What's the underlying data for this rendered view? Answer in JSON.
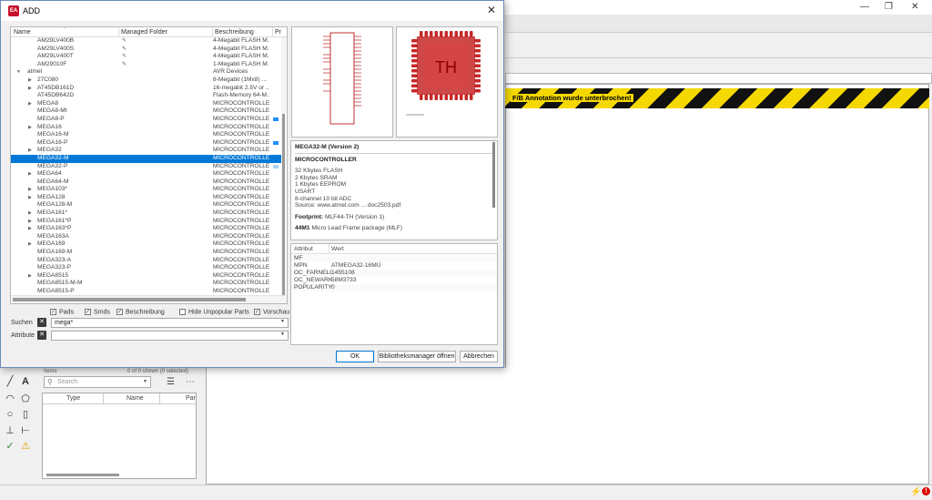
{
  "dialog": {
    "title": "ADD",
    "close": "✕"
  },
  "tree": {
    "columns": [
      "Name",
      "Managed Folder",
      "Beschreibung",
      "Pr"
    ],
    "rows": [
      {
        "name": "AM29LV400B",
        "desc": "4-Megabit FLASH M...",
        "pin": true
      },
      {
        "name": "AM29LV400S",
        "desc": "4-Megabit FLASH M...",
        "pin": true
      },
      {
        "name": "AM29LV400T",
        "desc": "4-Megabit FLASH M...",
        "pin": true
      },
      {
        "name": "AM29010F",
        "desc": "1-Megabit FLASH M...",
        "pin": true
      },
      {
        "name": "atmel",
        "desc": "AVR Devices",
        "group": true,
        "exp": "▼"
      },
      {
        "name": "27C080",
        "desc": "8-Megabit (1Mx8) ...",
        "exp": "▶"
      },
      {
        "name": "AT45DB161D",
        "desc": "16-megabit 2.5V or ...",
        "exp": "▶"
      },
      {
        "name": "AT45DB642D",
        "desc": "Flash-Memory 64-M..."
      },
      {
        "name": "MEGA8",
        "desc": "MICROCONTROLLER",
        "exp": "▶"
      },
      {
        "name": "MEGA8-MI",
        "desc": "MICROCONTROLLER"
      },
      {
        "name": "MEGA8-P",
        "desc": "MICROCONTROLLER",
        "mark": "dark"
      },
      {
        "name": "MEGA16",
        "desc": "MICROCONTROLLER",
        "exp": "▶"
      },
      {
        "name": "MEGA16-M",
        "desc": "MICROCONTROLLER"
      },
      {
        "name": "MEGA16-P",
        "desc": "MICROCONTROLLER",
        "mark": "dark"
      },
      {
        "name": "MEGA32",
        "desc": "MICROCONTROLLER",
        "exp": "▶"
      },
      {
        "name": "MEGA32-M",
        "desc": "MICROCONTROLLER",
        "sel": true
      },
      {
        "name": "MEGA32-P",
        "desc": "MICROCONTROLLER",
        "mark": "light"
      },
      {
        "name": "MEGA64",
        "desc": "MICROCONTROLLER",
        "exp": "▶"
      },
      {
        "name": "MEGA64-M",
        "desc": "MICROCONTROLLER"
      },
      {
        "name": "MEGA103*",
        "desc": "MICROCONTROLLER",
        "exp": "▶"
      },
      {
        "name": "MEGA128",
        "desc": "MICROCONTROLLER",
        "exp": "▶"
      },
      {
        "name": "MEGA128-M",
        "desc": "MICROCONTROLLER"
      },
      {
        "name": "MEGA161*",
        "desc": "MICROCONTROLLER",
        "exp": "▶"
      },
      {
        "name": "MEGA161*P",
        "desc": "MICROCONTROLLER",
        "exp": "▶"
      },
      {
        "name": "MEGA163*P",
        "desc": "MICROCONTROLLER",
        "exp": "▶"
      },
      {
        "name": "MEGA163A",
        "desc": "MICROCONTROLLER"
      },
      {
        "name": "MEGA169",
        "desc": "MICROCONTROLLER",
        "exp": "▶"
      },
      {
        "name": "MEGA169-M",
        "desc": "MICROCONTROLLER"
      },
      {
        "name": "MEGA323-A",
        "desc": "MICROCONTROLLER"
      },
      {
        "name": "MEGA323-P",
        "desc": "MICROCONTROLLER"
      },
      {
        "name": "MEGA8515",
        "desc": "MICROCONTROLLER",
        "exp": "▶"
      },
      {
        "name": "MEGA8515-M-M",
        "desc": "MICROCONTROLLER"
      },
      {
        "name": "MEGA8515-P",
        "desc": "MICROCONTROLLER"
      }
    ]
  },
  "filters": {
    "pads": "Pads",
    "smds": "Smds",
    "beschreibung": "Beschreibung",
    "hide_unpopular": "Hide Unpopular Parts",
    "vorschau": "Vorschau"
  },
  "search": {
    "label": "Suchen",
    "value": "mega*",
    "clear": "✕"
  },
  "attribute": {
    "label": "Attribute",
    "value": "",
    "clear": "✕"
  },
  "footprint_label": "TH",
  "description": {
    "title": "MEGA32-M (Version 2)",
    "subtitle": "MICROCONTROLLER",
    "lines": [
      "32 Kbytes FLASH",
      "2 Kbytes SRAM",
      "1 Kbytes EEPROM",
      "USART",
      "8-channel 10 bit ADC",
      "Source: www.atmel.com ... doc2503.pdf"
    ],
    "footprint_label": "Footprint:",
    "footprint": "MLF44-TH (Version 1)",
    "package_name": "44M1",
    "package_desc": "Micro Lead Frame package (MLF)"
  },
  "attributes": {
    "header_key": "Attribut",
    "header_val": "Wert",
    "rows": [
      {
        "k": "MF",
        "v": ""
      },
      {
        "k": "MPN",
        "v": "ATMEGA32-16MU"
      },
      {
        "k": "OC_FARNELL",
        "v": "1455108"
      },
      {
        "k": "OC_NEWARK",
        "v": "58M3733"
      },
      {
        "k": "POPULARITY",
        "v": "0"
      }
    ]
  },
  "buttons": {
    "ok": "OK",
    "manager": "Bibliotheksmanager öffnen",
    "cancel": "Abbrechen"
  },
  "background": {
    "warning": "F/B Annotation wurde unterbrochen!",
    "search_placeholder": "Search",
    "shown": "0 of 0 shown (0 selected)",
    "items": "Items",
    "cols": [
      "Type",
      "Name",
      "Par"
    ],
    "window_controls": [
      "—",
      "❐",
      "✕"
    ]
  }
}
